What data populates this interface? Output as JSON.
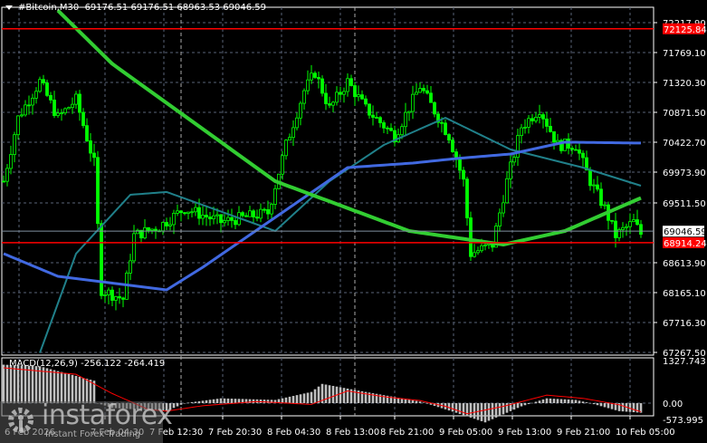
{
  "header": {
    "symbol": "#Bitcoin,M30",
    "open": "69176.51",
    "high": "69176.51",
    "low": "68963.53",
    "close": "69046.59"
  },
  "macd": {
    "label": "MACD(12,26,9)",
    "main": "-256.122",
    "signal": "-264.419"
  },
  "watermark": {
    "brand": "instaforex",
    "tagline": "Instant Forex Trading"
  },
  "price_axis": {
    "ticks": [
      "72217.90",
      "71769.10",
      "71320.30",
      "70871.50",
      "70422.70",
      "69973.90",
      "69511.50",
      "69046.59",
      "68613.90",
      "68165.10",
      "67716.30",
      "67267.50"
    ],
    "levels": [
      {
        "label": "72125.84",
        "value": 72125.84
      },
      {
        "label": "68914.24",
        "value": 68914.24
      }
    ],
    "current": {
      "label": "69046.59",
      "value": 69046.59
    }
  },
  "macd_axis": {
    "ticks": [
      "1327.743",
      "0.00",
      "-573.995"
    ]
  },
  "time_axis": {
    "labels": [
      "6 Feb 2026",
      "7 Feb 04:30",
      "7 Feb 12:30",
      "7 Feb 20:30",
      "8 Feb 04:30",
      "8 Feb 13:00",
      "8 Feb 21:00",
      "9 Feb 05:00",
      "9 Feb 13:00",
      "9 Feb 21:00",
      "10 Feb 05:00"
    ]
  },
  "colors": {
    "bull": "#00ff00",
    "bear": "#00ff00",
    "ma_slow": "#32cd32",
    "ma_mid": "#4169e1",
    "ma_fast": "#20808a",
    "level": "#ff0000",
    "macd_hist": "#c0c0c0",
    "macd_signal": "#ff0000",
    "grid": "#5a6478"
  },
  "chart_data": {
    "type": "candlestick",
    "price_range": [
      67160,
      72400
    ],
    "close_path": [
      [
        0,
        69838
      ],
      [
        4,
        70790
      ],
      [
        10,
        71334
      ],
      [
        15,
        70790
      ],
      [
        20,
        71062
      ],
      [
        25,
        70110
      ],
      [
        27,
        68206
      ],
      [
        33,
        68070
      ],
      [
        36,
        69022
      ],
      [
        43,
        69158
      ],
      [
        50,
        69430
      ],
      [
        60,
        69226
      ],
      [
        73,
        69362
      ],
      [
        78,
        70382
      ],
      [
        83,
        71198
      ],
      [
        86,
        71470
      ],
      [
        90,
        70926
      ],
      [
        95,
        71334
      ],
      [
        100,
        70926
      ],
      [
        108,
        70518
      ],
      [
        115,
        71266
      ],
      [
        123,
        70518
      ],
      [
        127,
        69838
      ],
      [
        129,
        68750
      ],
      [
        135,
        68886
      ],
      [
        139,
        69838
      ],
      [
        143,
        70654
      ],
      [
        148,
        70926
      ],
      [
        153,
        70382
      ],
      [
        158,
        70382
      ],
      [
        162,
        69838
      ],
      [
        166,
        69430
      ],
      [
        169,
        69022
      ],
      [
        174,
        69226
      ],
      [
        176,
        69047
      ]
    ],
    "ma_slow": [
      [
        15,
        72400
      ],
      [
        30,
        71600
      ],
      [
        75,
        69838
      ],
      [
        112,
        69090
      ],
      [
        138,
        68886
      ],
      [
        155,
        69090
      ],
      [
        176,
        69586
      ]
    ],
    "ma_mid": [
      [
        0,
        68750
      ],
      [
        15,
        68410
      ],
      [
        45,
        68206
      ],
      [
        55,
        68546
      ],
      [
        75,
        69294
      ],
      [
        95,
        70042
      ],
      [
        113,
        70110
      ],
      [
        125,
        70178
      ],
      [
        140,
        70246
      ],
      [
        155,
        70424
      ],
      [
        176,
        70410
      ]
    ],
    "ma_fast": [
      [
        10,
        67260
      ],
      [
        20,
        68750
      ],
      [
        35,
        69634
      ],
      [
        45,
        69676
      ],
      [
        75,
        69090
      ],
      [
        90,
        69838
      ],
      [
        105,
        70382
      ],
      [
        122,
        70790
      ],
      [
        140,
        70314
      ],
      [
        160,
        70042
      ],
      [
        176,
        69770
      ]
    ],
    "macd_hist": [
      [
        0,
        1200
      ],
      [
        10,
        1150
      ],
      [
        25,
        700
      ],
      [
        26,
        0
      ],
      [
        30,
        -150
      ],
      [
        45,
        -250
      ],
      [
        50,
        0
      ],
      [
        60,
        150
      ],
      [
        75,
        100
      ],
      [
        85,
        350
      ],
      [
        88,
        600
      ],
      [
        100,
        350
      ],
      [
        115,
        50
      ],
      [
        118,
        -50
      ],
      [
        125,
        -300
      ],
      [
        133,
        -600
      ],
      [
        143,
        -100
      ],
      [
        150,
        150
      ],
      [
        158,
        100
      ],
      [
        162,
        0
      ],
      [
        170,
        -250
      ],
      [
        176,
        -300
      ]
    ],
    "macd_signal": [
      [
        0,
        1100
      ],
      [
        20,
        900
      ],
      [
        30,
        300
      ],
      [
        40,
        -200
      ],
      [
        45,
        -250
      ],
      [
        55,
        -80
      ],
      [
        70,
        50
      ],
      [
        85,
        -40
      ],
      [
        95,
        380
      ],
      [
        105,
        200
      ],
      [
        115,
        80
      ],
      [
        122,
        -100
      ],
      [
        128,
        -330
      ],
      [
        138,
        -100
      ],
      [
        150,
        250
      ],
      [
        160,
        150
      ],
      [
        170,
        -50
      ],
      [
        176,
        -270
      ]
    ]
  }
}
